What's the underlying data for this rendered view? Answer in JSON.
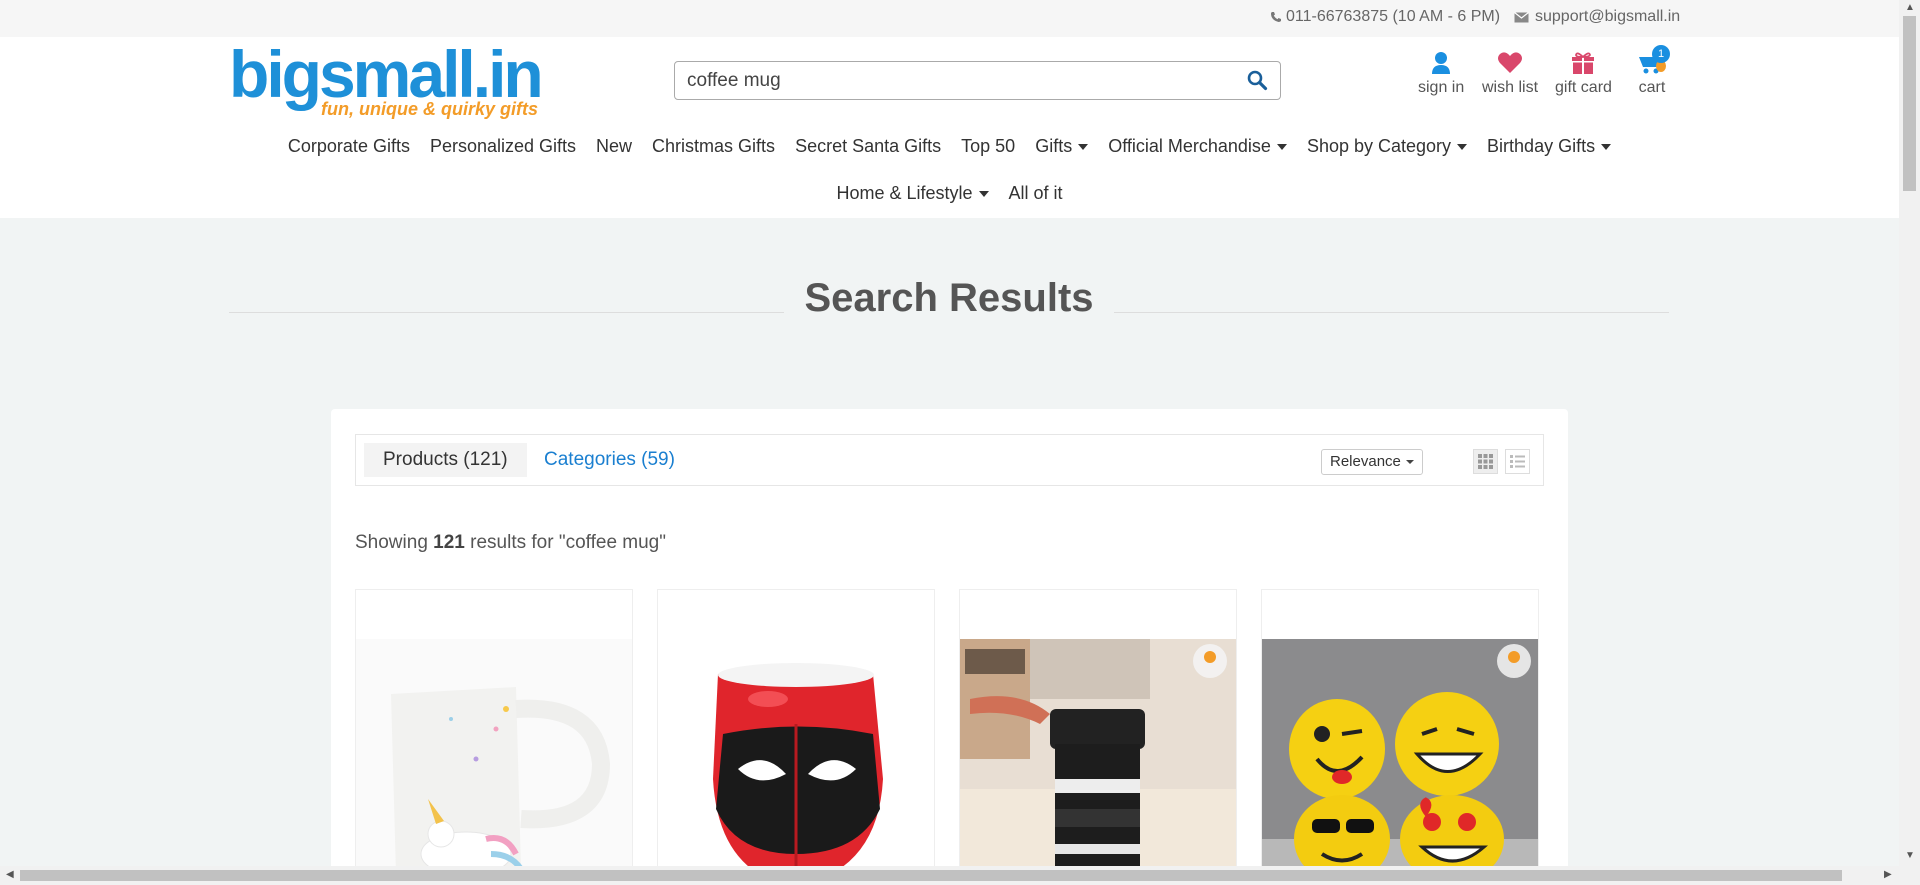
{
  "topbar": {
    "phone": "011-66763875 (10 AM - 6 PM)",
    "email": "support@bigsmall.in"
  },
  "logo": {
    "name": "bigsmall.in",
    "tagline": "fun, unique & quirky gifts"
  },
  "search": {
    "value": "coffee mug"
  },
  "header_icons": {
    "signin": "sign in",
    "wishlist": "wish list",
    "giftcard": "gift card",
    "cart": "cart",
    "cart_count": "1"
  },
  "nav": {
    "row1": [
      "Corporate Gifts",
      "Personalized Gifts",
      "New",
      "Christmas Gifts",
      "Secret Santa Gifts",
      "Top 50",
      "Gifts",
      "Official Merchandise",
      "Shop by Category",
      "Birthday Gifts"
    ],
    "row2": [
      "Home & Lifestyle",
      "All of it"
    ]
  },
  "page_title": "Search Results",
  "tabs": {
    "products": "Products (121)",
    "categories": "Categories (59)"
  },
  "sort": {
    "selected": "Relevance"
  },
  "results": {
    "prefix": "Showing",
    "count": "121",
    "suffix": "results for \"coffee mug\""
  },
  "products": [
    {
      "image": "unicorn-mug"
    },
    {
      "image": "deadpool-mug"
    },
    {
      "image": "camera-lens-mug"
    },
    {
      "image": "emoji-mugs"
    }
  ],
  "colors": {
    "brand_blue": "#1e90d8",
    "brand_orange": "#f39c28",
    "link_blue": "#1a7fd0",
    "heart_red": "#d9476b"
  }
}
